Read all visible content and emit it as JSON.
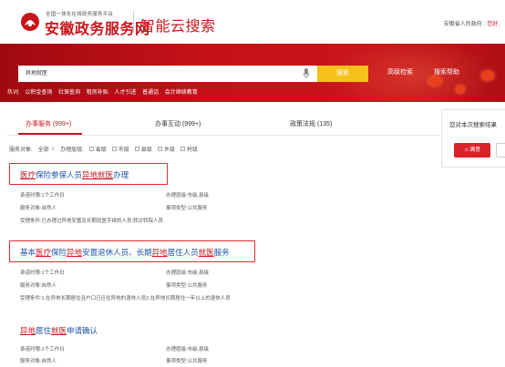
{
  "header": {
    "logo_small": "全国一体化在线政务服务平台",
    "logo_big": "安徽政务服务网",
    "logo_sub": "智能云搜索",
    "org": "安徽省人民政府",
    "greeting": "您好,"
  },
  "search": {
    "query": "异地就医",
    "button": "搜索",
    "advanced": "高级检索",
    "help": "搜索帮助",
    "hot_label": "热词:",
    "hot_words": [
      "公积金查询",
      "社保查询",
      "租房补贴",
      "人才引进",
      "普通话",
      "会计继续教育"
    ]
  },
  "tabs": [
    {
      "label": "办事服务 (999+)",
      "active": true
    },
    {
      "label": "办事互动 (999+)",
      "active": false
    },
    {
      "label": "政策法规 (135)",
      "active": false
    }
  ],
  "filter": {
    "object_label": "服务对象:",
    "object_value": "全部",
    "level_label": "办理层级:",
    "levels": [
      "省级",
      "市级",
      "县级",
      "乡级",
      "村级"
    ]
  },
  "results": [
    {
      "title_parts": [
        {
          "text": "医疗",
          "hl": true
        },
        {
          "text": "保险参保人员",
          "hl": false
        },
        {
          "text": "异地",
          "hl": true
        },
        {
          "text": "就医",
          "hl": true
        },
        {
          "text": "办理",
          "hl": false
        }
      ],
      "promise_time": "承诺时限:1个工作日",
      "service_object": "服务对象:自然人",
      "level": "办理层级:市级,县级",
      "type": "事项类型:公共服务",
      "condition": "受理条件:已办理过异地安置及长期就医手续的人员;转诊转院人员"
    },
    {
      "title_parts": [
        {
          "text": "基本",
          "hl": false
        },
        {
          "text": "医疗",
          "hl": true
        },
        {
          "text": "保险",
          "hl": false
        },
        {
          "text": "异地",
          "hl": true
        },
        {
          "text": "安置退休人员、长期",
          "hl": false
        },
        {
          "text": "异地",
          "hl": true
        },
        {
          "text": "居住人员",
          "hl": false
        },
        {
          "text": "就医",
          "hl": true
        },
        {
          "text": "服务",
          "hl": false
        }
      ],
      "promise_time": "承诺时限:1个工作日",
      "service_object": "服务对象:自然人",
      "level": "办理层级:市级,县级",
      "type": "事项类型:公共服务",
      "condition": "受理条件:1.在异地长期居住且户口已迁往异地的退休人员2.在异地长期居住一年以上的退休人员"
    },
    {
      "title_parts": [
        {
          "text": "异地",
          "hl": true
        },
        {
          "text": "居住",
          "hl": false
        },
        {
          "text": "就医",
          "hl": true
        },
        {
          "text": "申请确认",
          "hl": false
        }
      ],
      "promise_time": "承诺时限:1个工作日",
      "service_object": "服务对象:自然人",
      "level": "办理层级:市级,县级",
      "type": "事项类型:公共服务"
    }
  ],
  "side": {
    "question": "您对本次搜索结果",
    "satisfied": "满意"
  },
  "colors": {
    "brand_red": "#c8161d",
    "link_blue": "#1d54a5",
    "search_yellow": "#f6c21a",
    "box_red": "#e02b2b"
  }
}
